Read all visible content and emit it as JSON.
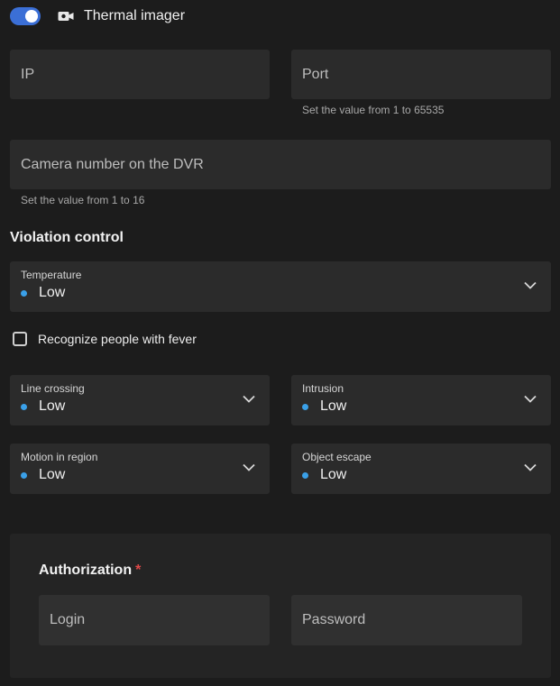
{
  "header": {
    "toggle_on": true,
    "camera_icon": "video-camera-icon",
    "title": "Thermal imager"
  },
  "connection": {
    "ip_label": "IP",
    "port_label": "Port",
    "port_hint": "Set the value from 1 to 65535",
    "camera_number_label": "Camera number on the DVR",
    "camera_number_hint": "Set the value from 1 to 16"
  },
  "violation_control": {
    "title": "Violation control",
    "temperature": {
      "label": "Temperature",
      "value": "Low"
    },
    "fever_checkbox_label": "Recognize people with fever",
    "fever_checked": false,
    "line_crossing": {
      "label": "Line crossing",
      "value": "Low"
    },
    "intrusion": {
      "label": "Intrusion",
      "value": "Low"
    },
    "motion_in_region": {
      "label": "Motion in region",
      "value": "Low"
    },
    "object_escape": {
      "label": "Object escape",
      "value": "Low"
    }
  },
  "authorization": {
    "title": "Authorization",
    "required_mark": "*",
    "login_label": "Login",
    "password_label": "Password"
  },
  "colors": {
    "accent": "#3b6fd6",
    "status_dot": "#3aa0e8",
    "required": "#e04848",
    "background": "#1c1c1c",
    "field": "#2b2b2b"
  }
}
